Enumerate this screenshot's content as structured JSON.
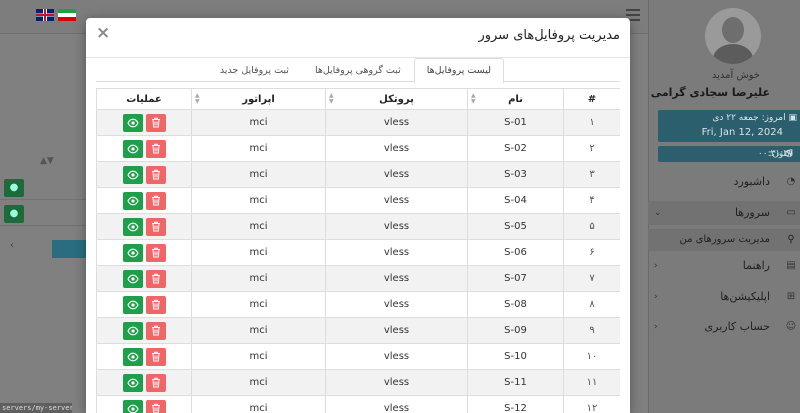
{
  "background": {
    "status_url": "servers/my-servers/#"
  },
  "sidebar": {
    "welcome": "خوش آمدید",
    "username": "علیرضا سجادی گرامی",
    "today_label": "امروز:",
    "today_fa": "جمعه ۲۲ دی",
    "today_en": "Fri, Jan 12, 2024",
    "now_label": "اکنون:",
    "now_value": "۰۰:۳۱:۳۷",
    "items": [
      {
        "label": "داشبورد",
        "icon": "dashboard-icon"
      },
      {
        "label": "سرورها",
        "icon": "server-icon",
        "active": true
      },
      {
        "label": "راهنما",
        "icon": "guide-icon"
      },
      {
        "label": "اپلیکیشن‌ها",
        "icon": "apps-icon"
      },
      {
        "label": "حساب کاربری",
        "icon": "user-icon"
      }
    ],
    "sub_item": "مدیریت سرورهای من"
  },
  "modal": {
    "title": "مدیریت پروفایل‌های سرور",
    "tabs": [
      {
        "label": "لیست پروفایل‌ها",
        "active": true
      },
      {
        "label": "ثبت گروهی پروفایل‌ها",
        "active": false
      },
      {
        "label": "ثبت پروفایل جدید",
        "active": false
      }
    ],
    "table": {
      "headers": [
        "#",
        "نام",
        "پروتکل",
        "اپراتور",
        "عملیات"
      ],
      "rows": [
        {
          "num": "۱",
          "name": "S-01",
          "protocol": "vless",
          "operator": "mci"
        },
        {
          "num": "۲",
          "name": "S-02",
          "protocol": "vless",
          "operator": "mci"
        },
        {
          "num": "۳",
          "name": "S-03",
          "protocol": "vless",
          "operator": "mci"
        },
        {
          "num": "۴",
          "name": "S-04",
          "protocol": "vless",
          "operator": "mci"
        },
        {
          "num": "۵",
          "name": "S-05",
          "protocol": "vless",
          "operator": "mci"
        },
        {
          "num": "۶",
          "name": "S-06",
          "protocol": "vless",
          "operator": "mci"
        },
        {
          "num": "۷",
          "name": "S-07",
          "protocol": "vless",
          "operator": "mci"
        },
        {
          "num": "۸",
          "name": "S-08",
          "protocol": "vless",
          "operator": "mci"
        },
        {
          "num": "۹",
          "name": "S-09",
          "protocol": "vless",
          "operator": "mci"
        },
        {
          "num": "۱۰",
          "name": "S-10",
          "protocol": "vless",
          "operator": "mci"
        },
        {
          "num": "۱۱",
          "name": "S-11",
          "protocol": "vless",
          "operator": "mci"
        },
        {
          "num": "۱۲",
          "name": "S-12",
          "protocol": "vless",
          "operator": "mci"
        }
      ]
    }
  },
  "colors": {
    "delete": "#f06565",
    "view": "#1ea04a",
    "accent": "#2b5f6d"
  }
}
